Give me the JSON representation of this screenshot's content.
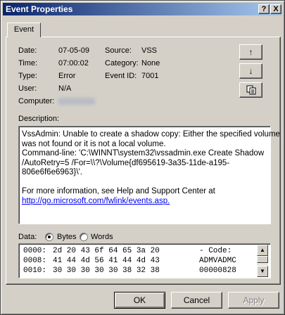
{
  "window": {
    "title": "Event Properties"
  },
  "titlebar": {
    "help": "?",
    "close": "X"
  },
  "tabs": [
    {
      "label": "Event"
    }
  ],
  "fields": {
    "date_label": "Date:",
    "date_value": "07-05-09",
    "time_label": "Time:",
    "time_value": "07:00:02",
    "type_label": "Type:",
    "type_value": "Error",
    "user_label": "User:",
    "user_value": "N/A",
    "computer_label": "Computer:",
    "source_label": "Source:",
    "source_value": "VSS",
    "category_label": "Category:",
    "category_value": "None",
    "eventid_label": "Event ID:",
    "eventid_value": "7001"
  },
  "side_buttons": {
    "up": "↑",
    "down": "↓",
    "copy": "copy-icon"
  },
  "description": {
    "label": "Description:",
    "lines": [
      "VssAdmin: Unable to create a shadow copy: Either the specified volume",
      "was not found or it is not a local volume.",
      "Command-line: 'C:\\WINNT\\system32\\vssadmin.exe Create Shadow",
      "/AutoRetry=5 /For=\\\\?\\Volume{df695619-3a35-11de-a195-",
      "806e6f6e6963}\\'.",
      "",
      "For more information, see Help and Support Center at"
    ],
    "link": "http://go.microsoft.com/fwlink/events.asp."
  },
  "data": {
    "label": "Data:",
    "bytes_label": "Bytes",
    "words_label": "Words",
    "selected": "Bytes",
    "rows": [
      {
        "offset": "0000:",
        "hex": "2d 20 43 6f 64 65 3a 20",
        "ascii": "- Code:"
      },
      {
        "offset": "0008:",
        "hex": "41 44 4d 56 41 44 4d 43",
        "ascii": "ADMVADMC"
      },
      {
        "offset": "0010:",
        "hex": "30 30 30 30 30 38 32 38",
        "ascii": "00000828"
      }
    ]
  },
  "buttons": {
    "ok": "OK",
    "cancel": "Cancel",
    "apply": "Apply"
  }
}
